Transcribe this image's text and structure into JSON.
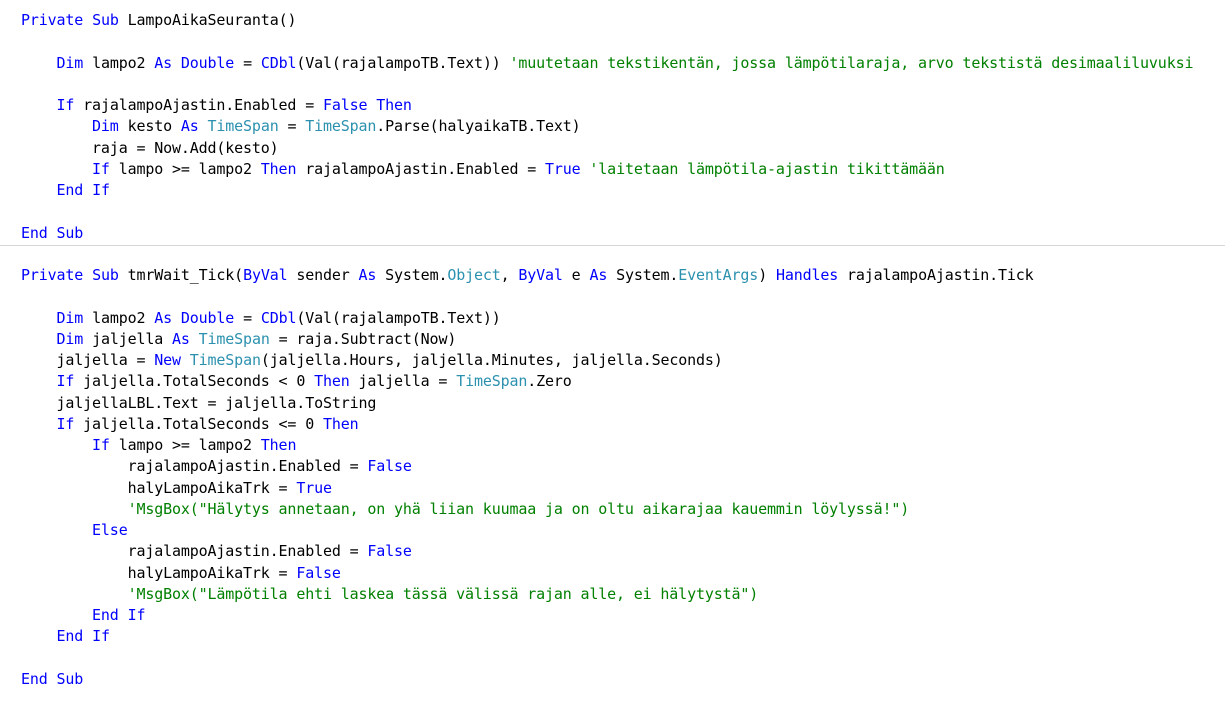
{
  "colors": {
    "keyword": "#0000ff",
    "type": "#2b91af",
    "comment": "#008000",
    "plain": "#000000",
    "separator": "#d6d6d6"
  },
  "lines": [
    {
      "indent": "",
      "tokens": [
        {
          "c": "keyword",
          "t": "Private"
        },
        {
          "c": "plain",
          "t": " "
        },
        {
          "c": "keyword",
          "t": "Sub"
        },
        {
          "c": "plain",
          "t": " LampoAikaSeuranta()"
        }
      ]
    },
    {
      "indent": "",
      "tokens": []
    },
    {
      "indent": "    ",
      "tokens": [
        {
          "c": "keyword",
          "t": "Dim"
        },
        {
          "c": "plain",
          "t": " lampo2 "
        },
        {
          "c": "keyword",
          "t": "As"
        },
        {
          "c": "plain",
          "t": " "
        },
        {
          "c": "keyword",
          "t": "Double"
        },
        {
          "c": "plain",
          "t": " = "
        },
        {
          "c": "keyword",
          "t": "CDbl"
        },
        {
          "c": "plain",
          "t": "(Val(rajalampoTB.Text)) "
        },
        {
          "c": "comment",
          "t": "'muutetaan tekstikentän, jossa lämpötilaraja, arvo tekstistä desimaaliluvuksi"
        }
      ]
    },
    {
      "indent": "",
      "tokens": []
    },
    {
      "indent": "    ",
      "tokens": [
        {
          "c": "keyword",
          "t": "If"
        },
        {
          "c": "plain",
          "t": " rajalampoAjastin.Enabled = "
        },
        {
          "c": "keyword",
          "t": "False"
        },
        {
          "c": "plain",
          "t": " "
        },
        {
          "c": "keyword",
          "t": "Then"
        }
      ]
    },
    {
      "indent": "        ",
      "tokens": [
        {
          "c": "keyword",
          "t": "Dim"
        },
        {
          "c": "plain",
          "t": " kesto "
        },
        {
          "c": "keyword",
          "t": "As"
        },
        {
          "c": "plain",
          "t": " "
        },
        {
          "c": "type",
          "t": "TimeSpan"
        },
        {
          "c": "plain",
          "t": " = "
        },
        {
          "c": "type",
          "t": "TimeSpan"
        },
        {
          "c": "plain",
          "t": ".Parse(halyaikaTB.Text)"
        }
      ]
    },
    {
      "indent": "        ",
      "tokens": [
        {
          "c": "plain",
          "t": "raja = Now.Add(kesto)"
        }
      ]
    },
    {
      "indent": "        ",
      "tokens": [
        {
          "c": "keyword",
          "t": "If"
        },
        {
          "c": "plain",
          "t": " lampo >= lampo2 "
        },
        {
          "c": "keyword",
          "t": "Then"
        },
        {
          "c": "plain",
          "t": " rajalampoAjastin.Enabled = "
        },
        {
          "c": "keyword",
          "t": "True"
        },
        {
          "c": "plain",
          "t": " "
        },
        {
          "c": "comment",
          "t": "'laitetaan lämpötila-ajastin tikittämään"
        }
      ]
    },
    {
      "indent": "    ",
      "tokens": [
        {
          "c": "keyword",
          "t": "End"
        },
        {
          "c": "plain",
          "t": " "
        },
        {
          "c": "keyword",
          "t": "If"
        }
      ]
    },
    {
      "indent": "",
      "tokens": []
    },
    {
      "indent": "",
      "tokens": [
        {
          "c": "keyword",
          "t": "End"
        },
        {
          "c": "plain",
          "t": " "
        },
        {
          "c": "keyword",
          "t": "Sub"
        }
      ]
    },
    {
      "indent": "",
      "tokens": [],
      "separator": true
    },
    {
      "indent": "",
      "tokens": [
        {
          "c": "keyword",
          "t": "Private"
        },
        {
          "c": "plain",
          "t": " "
        },
        {
          "c": "keyword",
          "t": "Sub"
        },
        {
          "c": "plain",
          "t": " tmrWait_Tick("
        },
        {
          "c": "keyword",
          "t": "ByVal"
        },
        {
          "c": "plain",
          "t": " sender "
        },
        {
          "c": "keyword",
          "t": "As"
        },
        {
          "c": "plain",
          "t": " System."
        },
        {
          "c": "type",
          "t": "Object"
        },
        {
          "c": "plain",
          "t": ", "
        },
        {
          "c": "keyword",
          "t": "ByVal"
        },
        {
          "c": "plain",
          "t": " e "
        },
        {
          "c": "keyword",
          "t": "As"
        },
        {
          "c": "plain",
          "t": " System."
        },
        {
          "c": "type",
          "t": "EventArgs"
        },
        {
          "c": "plain",
          "t": ") "
        },
        {
          "c": "keyword",
          "t": "Handles"
        },
        {
          "c": "plain",
          "t": " rajalampoAjastin.Tick"
        }
      ]
    },
    {
      "indent": "",
      "tokens": []
    },
    {
      "indent": "    ",
      "tokens": [
        {
          "c": "keyword",
          "t": "Dim"
        },
        {
          "c": "plain",
          "t": " lampo2 "
        },
        {
          "c": "keyword",
          "t": "As"
        },
        {
          "c": "plain",
          "t": " "
        },
        {
          "c": "keyword",
          "t": "Double"
        },
        {
          "c": "plain",
          "t": " = "
        },
        {
          "c": "keyword",
          "t": "CDbl"
        },
        {
          "c": "plain",
          "t": "(Val(rajalampoTB.Text))"
        }
      ]
    },
    {
      "indent": "    ",
      "tokens": [
        {
          "c": "keyword",
          "t": "Dim"
        },
        {
          "c": "plain",
          "t": " jaljella "
        },
        {
          "c": "keyword",
          "t": "As"
        },
        {
          "c": "plain",
          "t": " "
        },
        {
          "c": "type",
          "t": "TimeSpan"
        },
        {
          "c": "plain",
          "t": " = raja.Subtract(Now)"
        }
      ]
    },
    {
      "indent": "    ",
      "tokens": [
        {
          "c": "plain",
          "t": "jaljella = "
        },
        {
          "c": "keyword",
          "t": "New"
        },
        {
          "c": "plain",
          "t": " "
        },
        {
          "c": "type",
          "t": "TimeSpan"
        },
        {
          "c": "plain",
          "t": "(jaljella.Hours, jaljella.Minutes, jaljella.Seconds)"
        }
      ]
    },
    {
      "indent": "    ",
      "tokens": [
        {
          "c": "keyword",
          "t": "If"
        },
        {
          "c": "plain",
          "t": " jaljella.TotalSeconds < 0 "
        },
        {
          "c": "keyword",
          "t": "Then"
        },
        {
          "c": "plain",
          "t": " jaljella = "
        },
        {
          "c": "type",
          "t": "TimeSpan"
        },
        {
          "c": "plain",
          "t": ".Zero"
        }
      ]
    },
    {
      "indent": "    ",
      "tokens": [
        {
          "c": "plain",
          "t": "jaljellaLBL.Text = jaljella.ToString"
        }
      ]
    },
    {
      "indent": "    ",
      "tokens": [
        {
          "c": "keyword",
          "t": "If"
        },
        {
          "c": "plain",
          "t": " jaljella.TotalSeconds <= 0 "
        },
        {
          "c": "keyword",
          "t": "Then"
        }
      ]
    },
    {
      "indent": "        ",
      "tokens": [
        {
          "c": "keyword",
          "t": "If"
        },
        {
          "c": "plain",
          "t": " lampo >= lampo2 "
        },
        {
          "c": "keyword",
          "t": "Then"
        }
      ]
    },
    {
      "indent": "            ",
      "tokens": [
        {
          "c": "plain",
          "t": "rajalampoAjastin.Enabled = "
        },
        {
          "c": "keyword",
          "t": "False"
        }
      ]
    },
    {
      "indent": "            ",
      "tokens": [
        {
          "c": "plain",
          "t": "halyLampoAikaTrk = "
        },
        {
          "c": "keyword",
          "t": "True"
        }
      ]
    },
    {
      "indent": "            ",
      "tokens": [
        {
          "c": "comment",
          "t": "'MsgBox(\"Hälytys annetaan, on yhä liian kuumaa ja on oltu aikarajaa kauemmin löylyssä!\")"
        }
      ]
    },
    {
      "indent": "        ",
      "tokens": [
        {
          "c": "keyword",
          "t": "Else"
        }
      ]
    },
    {
      "indent": "            ",
      "tokens": [
        {
          "c": "plain",
          "t": "rajalampoAjastin.Enabled = "
        },
        {
          "c": "keyword",
          "t": "False"
        }
      ]
    },
    {
      "indent": "            ",
      "tokens": [
        {
          "c": "plain",
          "t": "halyLampoAikaTrk = "
        },
        {
          "c": "keyword",
          "t": "False"
        }
      ]
    },
    {
      "indent": "            ",
      "tokens": [
        {
          "c": "comment",
          "t": "'MsgBox(\"Lämpötila ehti laskea tässä välissä rajan alle, ei hälytystä\")"
        }
      ]
    },
    {
      "indent": "        ",
      "tokens": [
        {
          "c": "keyword",
          "t": "End"
        },
        {
          "c": "plain",
          "t": " "
        },
        {
          "c": "keyword",
          "t": "If"
        }
      ]
    },
    {
      "indent": "    ",
      "tokens": [
        {
          "c": "keyword",
          "t": "End"
        },
        {
          "c": "plain",
          "t": " "
        },
        {
          "c": "keyword",
          "t": "If"
        }
      ]
    },
    {
      "indent": "",
      "tokens": []
    },
    {
      "indent": "",
      "tokens": [
        {
          "c": "keyword",
          "t": "End"
        },
        {
          "c": "plain",
          "t": " "
        },
        {
          "c": "keyword",
          "t": "Sub"
        }
      ]
    }
  ]
}
